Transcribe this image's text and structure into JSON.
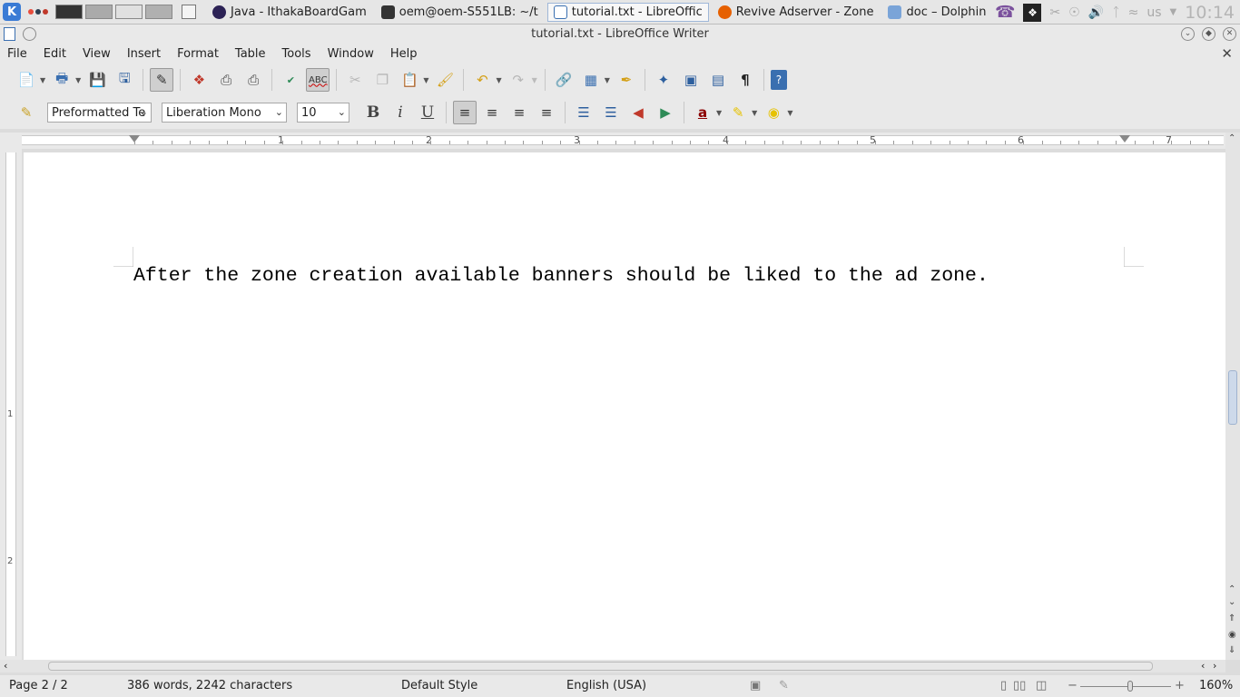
{
  "taskbar": {
    "tasks": [
      {
        "label": "Java - IthakaBoardGam",
        "active": false
      },
      {
        "label": "oem@oem-S551LB: ~/t",
        "active": false
      },
      {
        "label": "tutorial.txt - LibreOffic",
        "active": true
      },
      {
        "label": "Revive Adserver - Zone",
        "active": false
      },
      {
        "label": "doc – Dolphin",
        "active": false
      }
    ],
    "keyboard_layout": "us",
    "clock": "10:14"
  },
  "window": {
    "title": "tutorial.txt - LibreOffice Writer"
  },
  "menu": [
    "File",
    "Edit",
    "View",
    "Insert",
    "Format",
    "Table",
    "Tools",
    "Window",
    "Help"
  ],
  "formatting": {
    "paragraph_style": "Preformatted Te",
    "font_name": "Liberation Mono",
    "font_size": "10"
  },
  "ruler": {
    "h_numbers": [
      "1",
      "2",
      "3",
      "4",
      "5",
      "6",
      "7"
    ],
    "v_numbers": [
      "1",
      "2"
    ]
  },
  "document": {
    "text": "After the zone creation available banners should be liked to the ad zone."
  },
  "status": {
    "page": "Page 2 / 2",
    "word_count": "386 words, 2242 characters",
    "page_style": "Default Style",
    "language": "English (USA)",
    "zoom": "160%"
  }
}
